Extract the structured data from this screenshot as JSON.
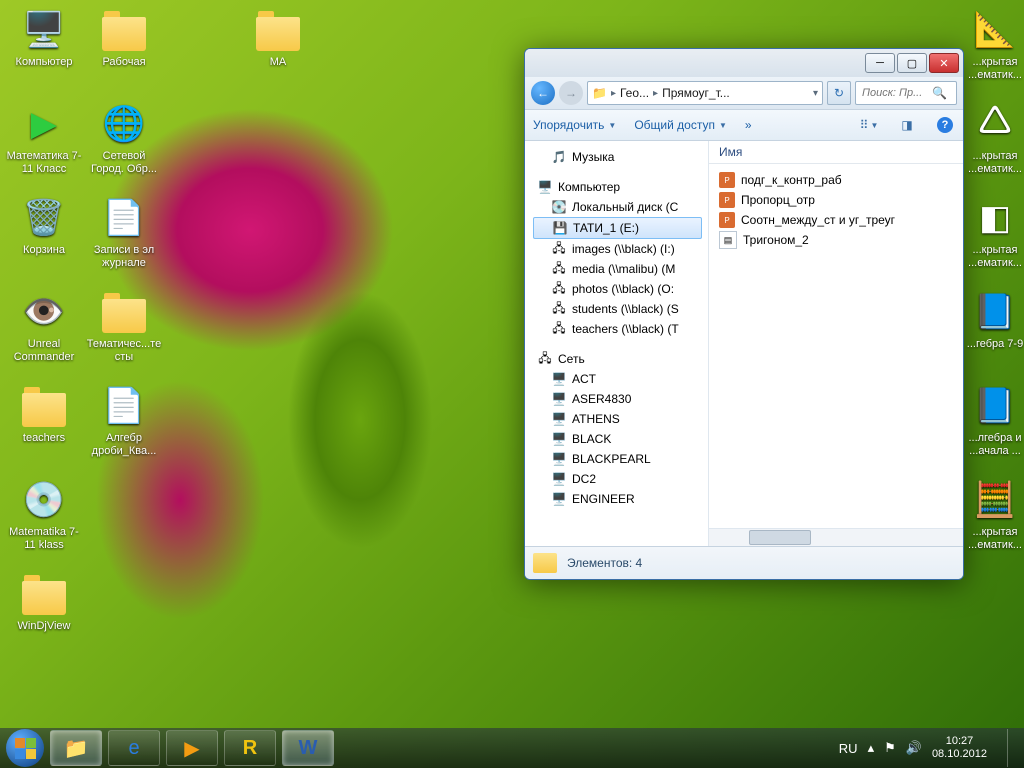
{
  "desktop_icons_left": [
    {
      "name": "computer",
      "label": "Компьютер",
      "icon": "🖥️"
    },
    {
      "name": "math-7-11",
      "label": "Математика 7-11 Класс",
      "icon": "▶",
      "color": "#2ecc40"
    },
    {
      "name": "recycle-bin",
      "label": "Корзина",
      "icon": "🗑️"
    },
    {
      "name": "unreal-commander",
      "label": "Unreal Commander",
      "icon": "👁️"
    },
    {
      "name": "teachers",
      "label": "teachers",
      "icon": "folder"
    },
    {
      "name": "matematika-klass",
      "label": "Matematika 7-11 klass",
      "icon": "💿"
    },
    {
      "name": "windjview",
      "label": "WinDjView",
      "icon": "folder"
    }
  ],
  "desktop_icons_col2": [
    {
      "name": "work-folder",
      "label": "Рабочая",
      "icon": "folder"
    },
    {
      "name": "network-city",
      "label": "Сетевой Город. Обр...",
      "icon": "🌐"
    },
    {
      "name": "journal-notes",
      "label": "Записи в эл журнале",
      "icon": "📄"
    },
    {
      "name": "thematic-tests",
      "label": "Тематичес...тесты",
      "icon": "folder"
    },
    {
      "name": "algebra-frac",
      "label": "Алгебр дроби_Ква...",
      "icon": "📄"
    }
  ],
  "desktop_icons_col3": [
    {
      "name": "ma-folder",
      "label": "MA",
      "icon": "folder"
    }
  ],
  "desktop_icons_right": [
    {
      "name": "open-math-1",
      "label": "...крытая ...ематик...",
      "icon": "📐"
    },
    {
      "name": "open-math-2",
      "label": "...крытая ...ематик...",
      "icon": "🛆"
    },
    {
      "name": "open-math-3",
      "label": "...крытая ...ематик...",
      "icon": "◧"
    },
    {
      "name": "algebra-7-9",
      "label": "...гебра 7-9",
      "icon": "📘"
    },
    {
      "name": "algebra-nachala",
      "label": "...лгебра и ...ачала ...",
      "icon": "📘"
    },
    {
      "name": "open-math-4",
      "label": "...крытая ...ематик...",
      "icon": "🧮"
    }
  ],
  "explorer": {
    "breadcrumb": {
      "seg1": "Гео...",
      "seg2": "Прямоуг_т..."
    },
    "search_placeholder": "Поиск: Пр...",
    "toolbar": {
      "organize": "Упорядочить",
      "share": "Общий доступ",
      "chevron": "»"
    },
    "nav": {
      "music": "Музыка",
      "computer": "Компьютер",
      "drives": [
        {
          "label": "Локальный диск (C",
          "icon": "💽"
        },
        {
          "label": "ТАТИ_1 (E:)",
          "icon": "💾",
          "selected": true
        },
        {
          "label": "images (\\\\black) (I:)",
          "icon": "🖧"
        },
        {
          "label": "media (\\\\malibu) (M",
          "icon": "🖧"
        },
        {
          "label": "photos (\\\\black) (O:",
          "icon": "🖧"
        },
        {
          "label": "students (\\\\black) (S",
          "icon": "🖧"
        },
        {
          "label": "teachers (\\\\black) (T",
          "icon": "🖧"
        }
      ],
      "network": "Сеть",
      "hosts": [
        "ACT",
        "ASER4830",
        "ATHENS",
        "BLACK",
        "BLACKPEARL",
        "DC2",
        "ENGINEER"
      ]
    },
    "column_header": "Имя",
    "files": [
      {
        "name": "подг_к_контр_раб",
        "type": "ppt"
      },
      {
        "name": "Пропорц_отр",
        "type": "ppt"
      },
      {
        "name": "Соотн_между_ст и уг_треуг",
        "type": "ppt"
      },
      {
        "name": "Тригоном_2",
        "type": "doc"
      }
    ],
    "status": "Элементов: 4"
  },
  "taskbar": {
    "lang": "RU",
    "time": "10:27",
    "date": "08.10.2012"
  }
}
